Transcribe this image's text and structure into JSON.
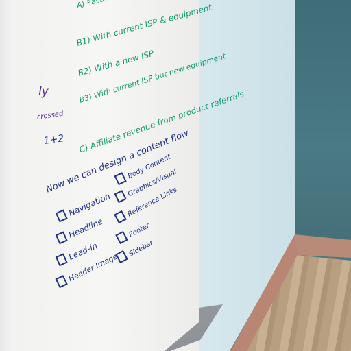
{
  "board": {
    "green_lines": [
      "A) Faster download speeds at home",
      "B1) With current ISP & equipment",
      "B2) With a new ISP",
      "B3) With current ISP but new equipment",
      "C) Affiliate revenue from product referrals"
    ],
    "margin_notes": [
      "ly",
      "crossed",
      "1+2"
    ],
    "heading": "Now we can design a content flow",
    "checklist_left": [
      "Navigation",
      "Headline",
      "Lead-in",
      "Header Image"
    ],
    "checklist_right": [
      "Body Content",
      "Graphics/Visual",
      "Reference Links",
      "Footer",
      "Sidebar"
    ]
  },
  "colors": {
    "green_ink": "#159a6e",
    "navy_ink": "#1e2f86",
    "purple_ink": "#5a2a9a",
    "teal_wall": "#4a7680"
  }
}
